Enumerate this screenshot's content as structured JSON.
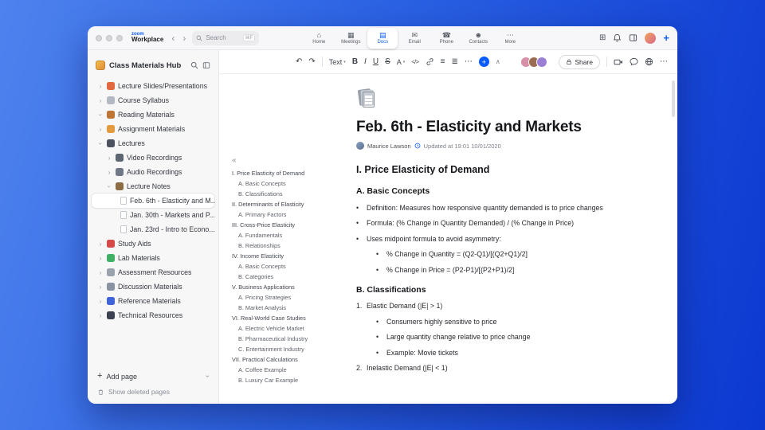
{
  "titlebar": {
    "logo_top": "zoom",
    "logo_bottom": "Workplace",
    "back_glyph": "‹",
    "forward_glyph": "›",
    "search_placeholder": "Search",
    "search_shortcut": "⌘F",
    "tabs": [
      {
        "name": "tab-home",
        "label": "Home",
        "glyph": "⌂"
      },
      {
        "name": "tab-meetings",
        "label": "Meetings",
        "glyph": "▦"
      },
      {
        "name": "tab-docs",
        "label": "Docs",
        "glyph": "▤",
        "active": true
      },
      {
        "name": "tab-email",
        "label": "Email",
        "glyph": "✉"
      },
      {
        "name": "tab-phone",
        "label": "Phone",
        "glyph": "☎"
      },
      {
        "name": "tab-contacts",
        "label": "Contacts",
        "glyph": "☻"
      },
      {
        "name": "tab-more",
        "label": "More",
        "glyph": "⋯"
      }
    ],
    "apps_glyph": "⊞",
    "plus_glyph": "+"
  },
  "sidebar": {
    "title": "Class Materials Hub",
    "items": [
      {
        "name": "sidebar-item-lecture-slides",
        "label": "Lecture Slides/Presentations",
        "chevron": "right",
        "icon": "slides",
        "color": "#e0693f",
        "indent": 0
      },
      {
        "name": "sidebar-item-course-syllabus",
        "label": "Course Syllabus",
        "chevron": "right",
        "icon": "syllabus",
        "color": "#b2b9c2",
        "indent": 0
      },
      {
        "name": "sidebar-item-reading-materials",
        "label": "Reading Materials",
        "chevron": "down",
        "icon": "reading-book",
        "color": "#bd7434",
        "indent": 0
      },
      {
        "name": "sidebar-item-assignment-materials",
        "label": "Assignment Materials",
        "chevron": "right",
        "icon": "assignment",
        "color": "#e39b40",
        "indent": 0
      },
      {
        "name": "sidebar-item-lectures",
        "label": "Lectures",
        "chevron": "down",
        "icon": "lectures",
        "color": "#4b5260",
        "indent": 0
      },
      {
        "name": "sidebar-item-video-recordings",
        "label": "Video Recordings",
        "chevron": "right",
        "icon": "video-recordings",
        "color": "#5d6572",
        "indent": 1
      },
      {
        "name": "sidebar-item-audio-recordings",
        "label": "Audio Recordings",
        "chevron": "right",
        "icon": "audio-recordings",
        "color": "#707886",
        "indent": 1
      },
      {
        "name": "sidebar-item-lecture-notes",
        "label": "Lecture Notes",
        "chevron": "down",
        "icon": "lecture-notes",
        "color": "#8d6c45",
        "indent": 1
      },
      {
        "name": "sidebar-item-feb-6-note",
        "label": "Feb. 6th - Elasticity and M...",
        "chevron": "",
        "icon": "page",
        "indent": 2,
        "selected": true
      },
      {
        "name": "sidebar-item-jan-30-note",
        "label": "Jan. 30th - Markets and P...",
        "chevron": "",
        "icon": "page",
        "indent": 2
      },
      {
        "name": "sidebar-item-jan-23-note",
        "label": "Jan. 23rd - Intro to Econo...",
        "chevron": "",
        "icon": "page",
        "indent": 2
      },
      {
        "name": "sidebar-item-study-aids",
        "label": "Study Aids",
        "chevron": "right",
        "icon": "study-aids",
        "color": "#d64949",
        "indent": 0
      },
      {
        "name": "sidebar-item-lab-materials",
        "label": "Lab Materials",
        "chevron": "right",
        "icon": "lab-materials",
        "color": "#41b065",
        "indent": 0
      },
      {
        "name": "sidebar-item-assessment-resources",
        "label": "Assessment Resources",
        "chevron": "right",
        "icon": "assessment",
        "color": "#9aa2ad",
        "indent": 0
      },
      {
        "name": "sidebar-item-discussion-materials",
        "label": "Discussion Materials",
        "chevron": "right",
        "icon": "discussion",
        "color": "#8a93a1",
        "indent": 0
      },
      {
        "name": "sidebar-item-reference-materials",
        "label": "Reference Materials",
        "chevron": "right",
        "icon": "reference",
        "color": "#3f63d8",
        "indent": 0
      },
      {
        "name": "sidebar-item-technical-resources",
        "label": "Technical Resources",
        "chevron": "right",
        "icon": "technical",
        "color": "#3a4252",
        "indent": 0
      }
    ],
    "add_page_plus": "+",
    "add_page_label": "Add page",
    "show_deleted_label": "Show deleted pages"
  },
  "toolbar": {
    "undo_glyph": "↶",
    "redo_glyph": "↷",
    "text_style_label": "Text",
    "caret_glyph": "▾",
    "bold_label": "B",
    "italic_label": "I",
    "underline_label": "U",
    "strike_label": "S",
    "color_label": "A",
    "code_label": "</>",
    "bullet_list_glyph": "≡",
    "ordered_list_glyph": "≣",
    "more_glyph": "⋯",
    "insert_plus": "+",
    "collapse_glyph": "∧",
    "share_label": "Share",
    "overflow_glyph": "⋯",
    "avatars": [
      {
        "bg": "#d88fa8"
      },
      {
        "bg": "#9a6b52"
      },
      {
        "bg": "#9b7fd4"
      }
    ]
  },
  "outline": {
    "collapse_glyph": "«",
    "items": [
      {
        "text": "I. Price Elasticity of Demand",
        "level": 0
      },
      {
        "text": "A. Basic Concepts",
        "level": 1
      },
      {
        "text": "B. Classifications",
        "level": 1
      },
      {
        "text": "II. Determinants of Elasticity",
        "level": 0
      },
      {
        "text": "A. Primary Factors",
        "level": 1
      },
      {
        "text": "III. Cross-Price Elasticity",
        "level": 0
      },
      {
        "text": "A. Fundamentals",
        "level": 1
      },
      {
        "text": "B. Relationships",
        "level": 1
      },
      {
        "text": "IV. Income Elasticity",
        "level": 0
      },
      {
        "text": "A. Basic Concepts",
        "level": 1
      },
      {
        "text": "B. Categories",
        "level": 1
      },
      {
        "text": "V. Business Applications",
        "level": 0
      },
      {
        "text": "A. Pricing Strategies",
        "level": 1
      },
      {
        "text": "B. Market Analysis",
        "level": 1
      },
      {
        "text": "VI. Real-World Case Studies",
        "level": 0
      },
      {
        "text": "A. Electric Vehicle Market",
        "level": 1
      },
      {
        "text": "B. Pharmaceutical Industry",
        "level": 1
      },
      {
        "text": "C. Entertainment Industry",
        "level": 1
      },
      {
        "text": "VII. Practical Calculations",
        "level": 0
      },
      {
        "text": "A. Coffee Example",
        "level": 1
      },
      {
        "text": "B. Luxury Car Example",
        "level": 1
      }
    ]
  },
  "doc": {
    "title": "Feb. 6th - Elasticity and Markets",
    "author": "Maurice Lawson",
    "updated_text": "Updated at 19:01 10/01/2020",
    "blocks": [
      {
        "kind": "h2",
        "text": "I. Price Elasticity of Demand"
      },
      {
        "kind": "h3",
        "text": "A. Basic Concepts"
      },
      {
        "kind": "li",
        "marker": "•",
        "indent": 0,
        "text": "Definition: Measures how responsive quantity demanded is to price changes"
      },
      {
        "kind": "li",
        "marker": "•",
        "indent": 0,
        "text": "Formula: (% Change in Quantity Demanded) / (% Change in Price)"
      },
      {
        "kind": "li",
        "marker": "•",
        "indent": 0,
        "text": "Uses midpoint formula to avoid asymmetry:"
      },
      {
        "kind": "li",
        "marker": "•",
        "indent": 1,
        "text": "% Change in Quantity = (Q2-Q1)/[(Q2+Q1)/2]"
      },
      {
        "kind": "li",
        "marker": "•",
        "indent": 1,
        "text": "% Change in Price = (P2-P1)/[(P2+P1)/2]"
      },
      {
        "kind": "h3",
        "text": "B. Classifications"
      },
      {
        "kind": "li",
        "marker": "1.",
        "indent": 0,
        "text": "Elastic Demand (|E| > 1)"
      },
      {
        "kind": "li",
        "marker": "•",
        "indent": 1,
        "text": "Consumers highly sensitive to price"
      },
      {
        "kind": "li",
        "marker": "•",
        "indent": 1,
        "text": "Large quantity change relative to price change"
      },
      {
        "kind": "li",
        "marker": "•",
        "indent": 1,
        "text": "Example: Movie tickets"
      },
      {
        "kind": "li",
        "marker": "2.",
        "indent": 0,
        "text": "Inelastic Demand (|E| < 1)"
      }
    ]
  },
  "colors": {
    "accent": "#0b5cff"
  }
}
